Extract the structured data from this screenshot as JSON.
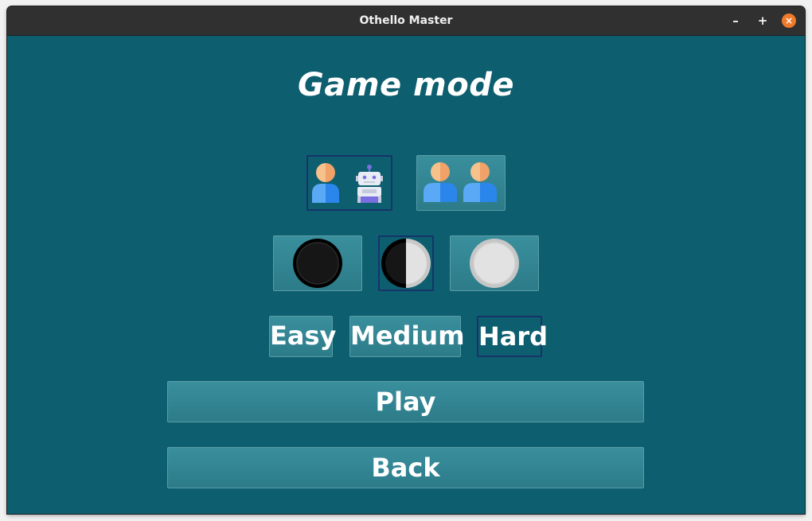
{
  "window": {
    "title": "Othello Master",
    "controls": {
      "minimize": "–",
      "maximize": "+",
      "close": "×"
    }
  },
  "screen": {
    "heading": "Game mode"
  },
  "modes": {
    "options": [
      "person-vs-robot-icon",
      "person-vs-person-icon"
    ],
    "selected": "person-vs-robot-icon"
  },
  "colors": {
    "options": [
      "black-disc-icon",
      "half-black-half-white-disc-icon",
      "white-disc-icon"
    ],
    "selected": "half-black-half-white-disc-icon"
  },
  "difficulty": {
    "easy": "Easy",
    "medium": "Medium",
    "hard": "Hard",
    "selected": "Hard"
  },
  "actions": {
    "play": "Play",
    "back": "Back"
  },
  "palette": {
    "background": "#0d5e6e",
    "button": "#3a8f9d",
    "selected_border": "#17336a",
    "titlebar": "#303030",
    "close_button": "#ef7a29"
  }
}
